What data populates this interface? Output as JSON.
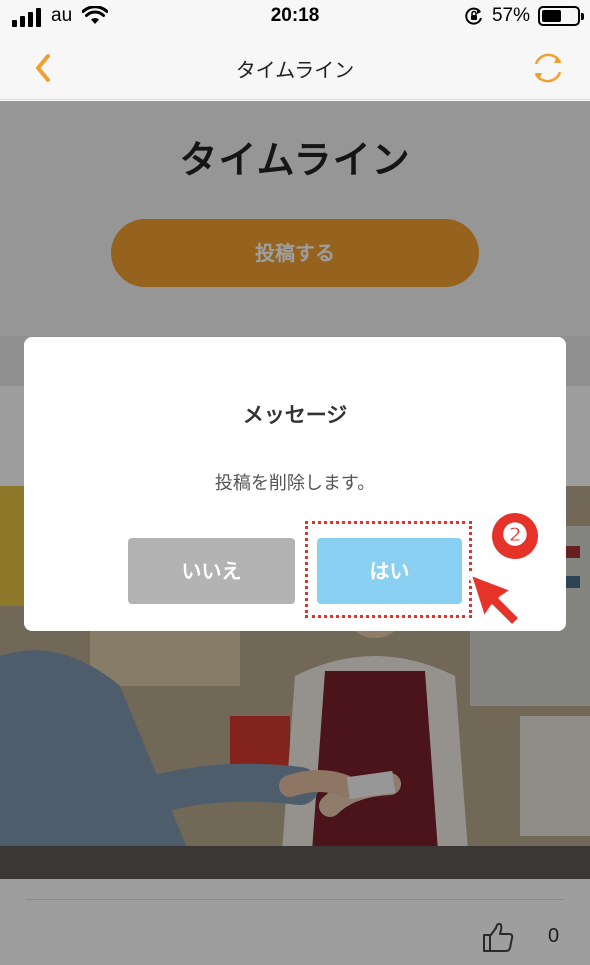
{
  "status_bar": {
    "carrier": "au",
    "time": "20:18",
    "battery_percent": "57%",
    "battery_level": 0.57,
    "icons": [
      "signal-icon",
      "wifi-icon",
      "orientation-lock-icon",
      "battery-icon"
    ]
  },
  "nav": {
    "title": "タイムライン",
    "back_icon": "chevron-left-icon",
    "refresh_icon": "refresh-icon"
  },
  "page": {
    "title": "タイムライン",
    "post_button_label": "投稿する"
  },
  "post": {
    "like_count": "0",
    "like_icon": "thumbs-up-icon"
  },
  "dialog": {
    "title": "メッセージ",
    "message": "投稿を削除します。",
    "no_label": "いいえ",
    "yes_label": "はい"
  },
  "annotation": {
    "step_number": "❷",
    "color": "#e5332a"
  },
  "colors": {
    "accent_orange": "#f0a030",
    "yes_button": "#8ad0f2",
    "no_button": "#b3b3b3"
  }
}
